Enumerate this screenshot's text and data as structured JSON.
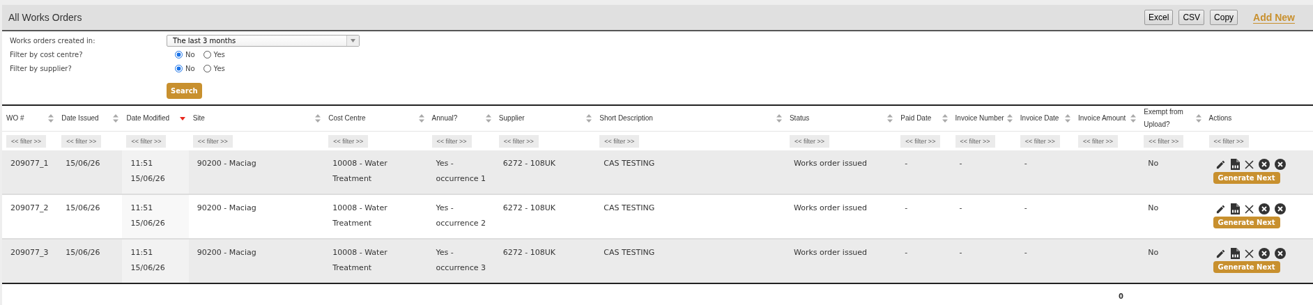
{
  "header": {
    "title": "All Works Orders",
    "exports": [
      "Excel",
      "CSV",
      "Copy"
    ],
    "add_link": "Add New"
  },
  "filters": {
    "created_in": {
      "label": "Works orders created in:",
      "value": "The last 3 months"
    },
    "radios": [
      {
        "label": "Filter by cost centre?",
        "options": [
          {
            "label": "No",
            "selected": true
          },
          {
            "label": "Yes",
            "selected": false
          }
        ]
      },
      {
        "label": "Filter by supplier?",
        "options": [
          {
            "label": "No",
            "selected": true
          },
          {
            "label": "Yes",
            "selected": false
          }
        ]
      }
    ],
    "search_button": "Search"
  },
  "table": {
    "columns": [
      {
        "label": "WO #",
        "sortable": true,
        "sorted_descending": false,
        "filter": "<< filter >>"
      },
      {
        "label": "Date Issued",
        "sortable": true,
        "sorted_descending": false,
        "filter": "<< filter >>"
      },
      {
        "label": "Date Modified",
        "sortable": true,
        "sorted_descending": true,
        "filter": "<< filter >>"
      },
      {
        "label": "Site",
        "sortable": true,
        "sorted_descending": false,
        "filter": "<< filter >>"
      },
      {
        "label": "Cost Centre",
        "sortable": true,
        "sorted_descending": false,
        "filter": "<< filter >>"
      },
      {
        "label": "Annual?",
        "sortable": true,
        "sorted_descending": false,
        "filter": "<< filter >>"
      },
      {
        "label": "Supplier",
        "sortable": true,
        "sorted_descending": false,
        "filter": "<< filter >>"
      },
      {
        "label": "Short Description",
        "sortable": true,
        "sorted_descending": false,
        "filter": "<< filter >>"
      },
      {
        "label": "Status",
        "sortable": true,
        "sorted_descending": false,
        "filter": "<< filter >>"
      },
      {
        "label": "Paid Date",
        "sortable": true,
        "sorted_descending": false,
        "filter": "<< filter >>"
      },
      {
        "label": "Invoice Number",
        "sortable": true,
        "sorted_descending": false,
        "filter": "<< filter >>"
      },
      {
        "label": "Invoice Date",
        "sortable": true,
        "sorted_descending": false,
        "filter": "<< filter >>"
      },
      {
        "label": "Invoice Amount",
        "sortable": true,
        "sorted_descending": false,
        "filter": "<< filter >>"
      },
      {
        "label": "Exempt from Upload?",
        "sortable": true,
        "sorted_descending": false,
        "filter": "<< filter >>"
      },
      {
        "label": "Actions",
        "sortable": false,
        "filter": "<< filter >>"
      }
    ],
    "rows": [
      {
        "cells": [
          "209077_1",
          "15/06/26",
          "11:51 15/06/26",
          "90200 - Maciag",
          "10008 - Water Treatment",
          "Yes - occurrence 1",
          "6272 - 108UK",
          "CAS TESTING",
          "Works order issued",
          "-",
          "-",
          "-",
          "",
          "No"
        ],
        "action_button": "Generate Next"
      },
      {
        "cells": [
          "209077_2",
          "15/06/26",
          "11:51 15/06/26",
          "90200 - Maciag",
          "10008 - Water Treatment",
          "Yes - occurrence 2",
          "6272 - 108UK",
          "CAS TESTING",
          "Works order issued",
          "-",
          "-",
          "-",
          "",
          "No"
        ],
        "action_button": "Generate Next"
      },
      {
        "cells": [
          "209077_3",
          "15/06/26",
          "11:51 15/06/26",
          "90200 - Maciag",
          "10008 - Water Treatment",
          "Yes - occurrence 3",
          "6272 - 108UK",
          "CAS TESTING",
          "Works order issued",
          "-",
          "-",
          "-",
          "",
          "No"
        ],
        "action_button": "Generate Next"
      }
    ],
    "footer_total": "0"
  }
}
